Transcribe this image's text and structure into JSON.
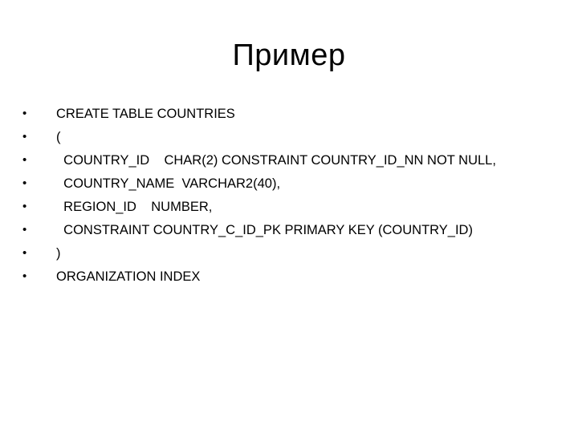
{
  "slide": {
    "title": "Пример",
    "bullet_glyph": "•",
    "lines": [
      "CREATE TABLE COUNTRIES",
      "(",
      "  COUNTRY_ID    CHAR(2) CONSTRAINT COUNTRY_ID_NN NOT NULL,",
      "  COUNTRY_NAME  VARCHAR2(40),",
      "  REGION_ID    NUMBER,",
      "  CONSTRAINT COUNTRY_C_ID_PK PRIMARY KEY (COUNTRY_ID)",
      ")",
      "ORGANIZATION INDEX"
    ]
  }
}
